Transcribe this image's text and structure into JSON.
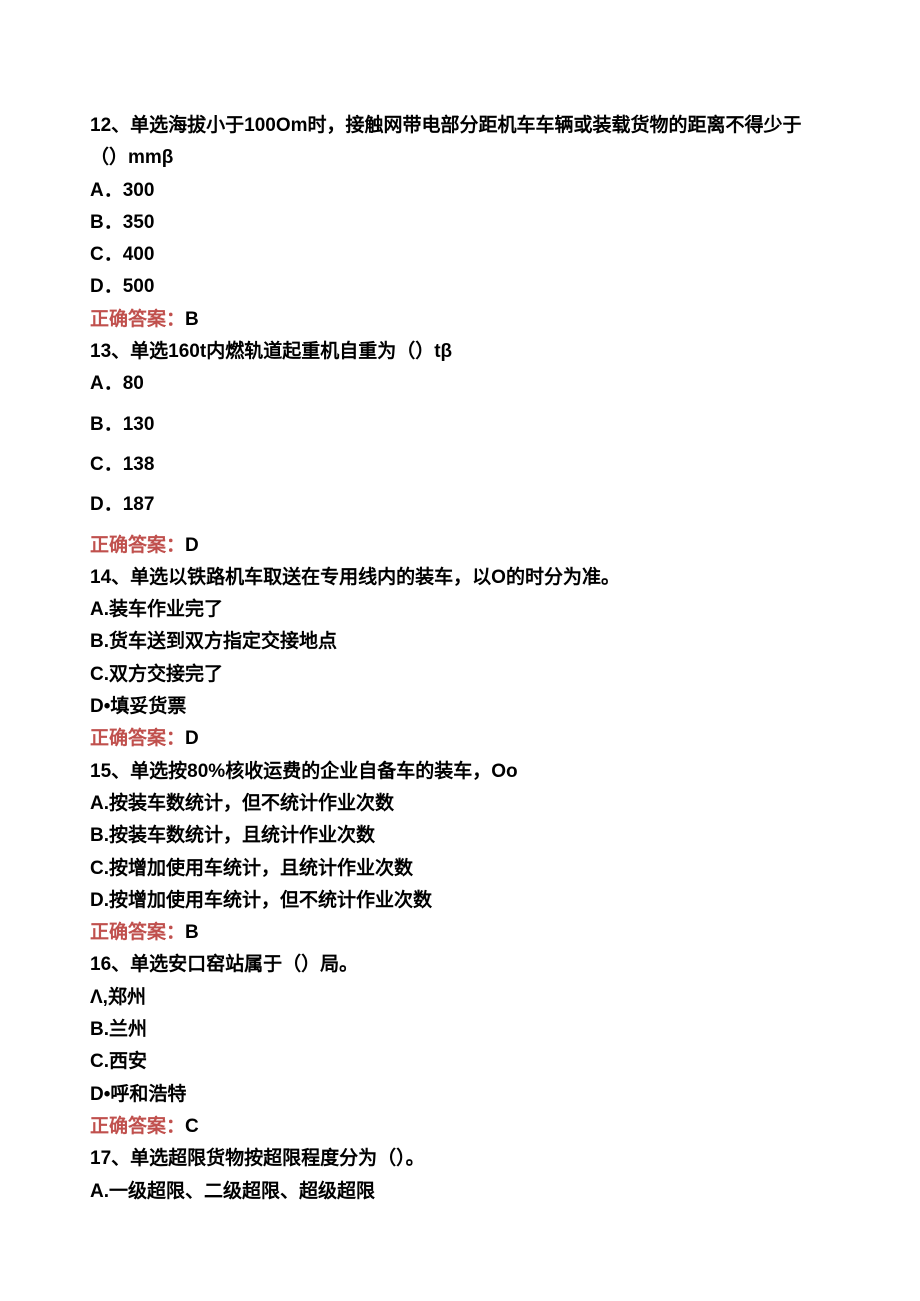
{
  "answer_label": "正确答案：",
  "questions": [
    {
      "number": "12",
      "type": "单选",
      "stem_line1": "海拔小于100Om时，接触网带电部分距机车车辆或装载货物的距离不得少于",
      "stem_line2": "（）mmβ",
      "options": [
        "A．300",
        "B．350",
        "C．400",
        "D．500"
      ],
      "answer": "B"
    },
    {
      "number": "13",
      "type": "单选",
      "stem_line1": "160t内燃轨道起重机自重为（）tβ",
      "options": [
        "A．80",
        "B．130",
        "C．138",
        "D．187"
      ],
      "answer": "D"
    },
    {
      "number": "14",
      "type": "单选",
      "stem_line1": "以铁路机车取送在专用线内的装车，以O的时分为准。",
      "options": [
        "A.装车作业完了",
        "B.货车送到双方指定交接地点",
        "C.双方交接完了",
        "D•填妥货票"
      ],
      "answer": "D"
    },
    {
      "number": "15",
      "type": "单选",
      "stem_line1": "按80%核收运费的企业自备车的装车，Oo",
      "options": [
        "A.按装车数统计，但不统计作业次数",
        "B.按装车数统计，且统计作业次数",
        "C.按增加使用车统计，且统计作业次数",
        "D.按增加使用车统计，但不统计作业次数"
      ],
      "answer": "B"
    },
    {
      "number": "16",
      "type": "单选",
      "stem_line1": "安口窑站属于（）局。",
      "options": [
        "Λ,郑州",
        "B.兰州",
        "C.西安",
        "D•呼和浩特"
      ],
      "answer": "C"
    },
    {
      "number": "17",
      "type": "单选",
      "stem_line1": "超限货物按超限程度分为（）。",
      "options": [
        "A.一级超限、二级超限、超级超限"
      ],
      "answer": null
    }
  ]
}
